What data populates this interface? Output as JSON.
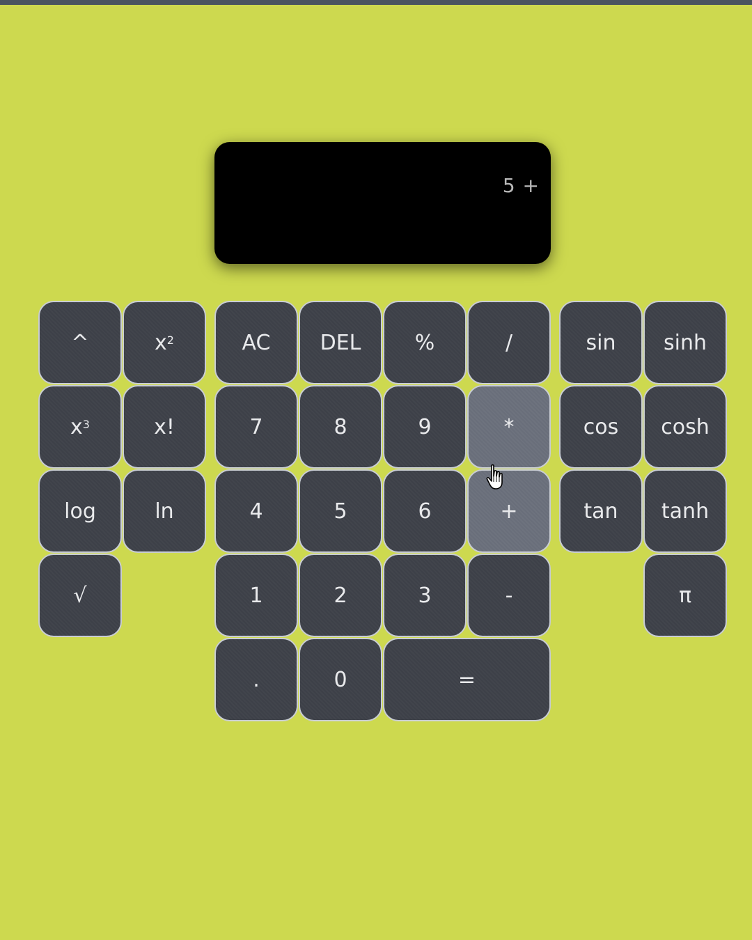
{
  "display": {
    "expression": "5 +",
    "result": ""
  },
  "keys": {
    "caret": "^",
    "square_base": "x",
    "square_exp": "2",
    "cube_base": "x",
    "cube_exp": "3",
    "factorial": "x!",
    "log": "log",
    "ln": "ln",
    "sqrt": "√",
    "ac": "AC",
    "del": "DEL",
    "percent": "%",
    "divide": "/",
    "seven": "7",
    "eight": "8",
    "nine": "9",
    "multiply": "*",
    "four": "4",
    "five": "5",
    "six": "6",
    "plus": "+",
    "one": "1",
    "two": "2",
    "three": "3",
    "minus": "-",
    "dot": ".",
    "zero": "0",
    "equals": "=",
    "sin": "sin",
    "sinh": "sinh",
    "cos": "cos",
    "cosh": "cosh",
    "tan": "tan",
    "tanh": "tanh",
    "pi": "π"
  },
  "colors": {
    "background": "#cdd94f",
    "key": "#3e4149",
    "key_highlight": "#6b707c",
    "display": "#000000"
  },
  "icons": {
    "cursor": "hand-pointer-icon"
  }
}
